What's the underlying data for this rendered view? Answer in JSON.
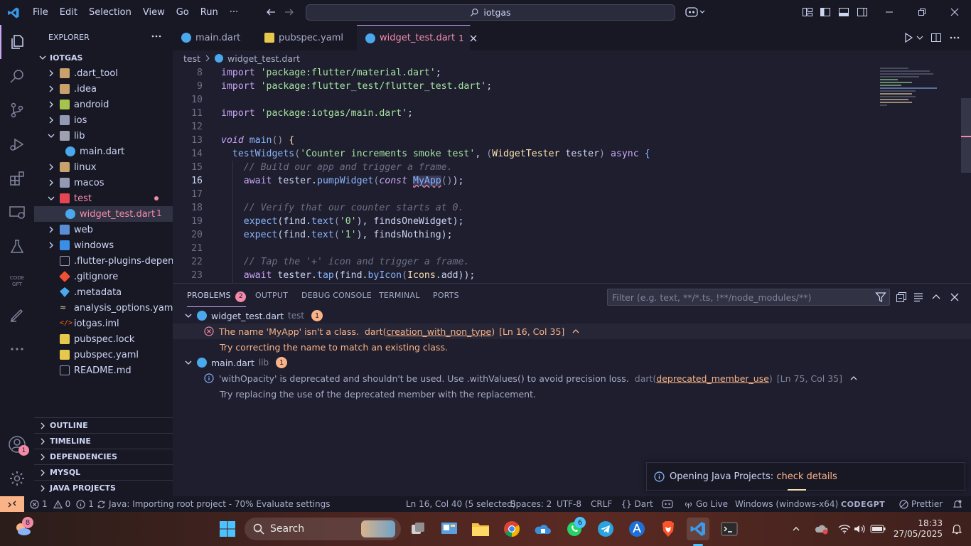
{
  "menu": [
    "File",
    "Edit",
    "Selection",
    "View",
    "Go",
    "Run",
    "···"
  ],
  "search": {
    "value": "iotgas"
  },
  "explorer": {
    "title": "EXPLORER",
    "root": "IOTGAS",
    "items": [
      {
        "label": ".dart_tool"
      },
      {
        "label": ".idea"
      },
      {
        "label": "android"
      },
      {
        "label": "ios"
      },
      {
        "label": "lib"
      },
      {
        "label": "main.dart"
      },
      {
        "label": "linux"
      },
      {
        "label": "macos"
      },
      {
        "label": "test"
      },
      {
        "label": "widget_test.dart",
        "badge": "1"
      },
      {
        "label": "web"
      },
      {
        "label": "windows"
      },
      {
        "label": ".flutter-plugins-depen..."
      },
      {
        "label": ".gitignore"
      },
      {
        "label": ".metadata"
      },
      {
        "label": "analysis_options.yaml"
      },
      {
        "label": "iotgas.iml"
      },
      {
        "label": "pubspec.lock"
      },
      {
        "label": "pubspec.yaml"
      },
      {
        "label": "README.md"
      }
    ],
    "sections": [
      "OUTLINE",
      "TIMELINE",
      "DEPENDENCIES",
      "MYSQL",
      "JAVA PROJECTS"
    ]
  },
  "tabs": [
    {
      "label": "main.dart"
    },
    {
      "label": "pubspec.yaml"
    },
    {
      "label": "widget_test.dart",
      "badge": "1"
    }
  ],
  "breadcrumb": [
    "test",
    "widget_test.dart"
  ],
  "code": {
    "line_numbers": [
      "8",
      "9",
      "10",
      "11",
      "12",
      "13",
      "14",
      "15",
      "16",
      "17",
      "18",
      "19",
      "20",
      "21",
      "22",
      "23"
    ],
    "l8": [
      "import",
      " ",
      "'package:flutter/material.dart'",
      ";"
    ],
    "l9": [
      "import",
      " ",
      "'package:flutter_test/flutter_test.dart'",
      ";"
    ],
    "l11": [
      "import",
      " ",
      "'package:iotgas/main.dart'",
      ";"
    ],
    "l13": [
      "void",
      " ",
      "main",
      "()",
      " {"
    ],
    "l14": [
      "testWidgets",
      "(",
      "'Counter increments smoke test'",
      ", ",
      "(",
      "WidgetTester",
      " tester",
      ")",
      " ",
      "async",
      " {"
    ],
    "l15": "// Build our app and trigger a frame.",
    "l16": [
      "await",
      " tester.",
      "pumpWidget",
      "(",
      "const",
      " ",
      "MyApp",
      "()",
      ");"
    ],
    "l18": "// Verify that our counter starts at 0.",
    "l19": [
      "expect",
      "(find.",
      "text",
      "(",
      "'0'",
      "), findsOneWidget);"
    ],
    "l20": [
      "expect",
      "(find.",
      "text",
      "(",
      "'1'",
      "), findsNothing);"
    ],
    "l22": "// Tap the '+' icon and trigger a frame.",
    "l23": [
      "await",
      " tester.",
      "tap",
      "(find.",
      "byIcon",
      "(",
      "Icons",
      ".add));"
    ]
  },
  "panel": {
    "tabs": [
      "PROBLEMS",
      "OUTPUT",
      "DEBUG CONSOLE",
      "TERMINAL",
      "PORTS"
    ],
    "problems_count": "2",
    "filter_placeholder": "Filter (e.g. text, **/*.ts, !**/node_modules/**)",
    "groups": [
      {
        "file": "widget_test.dart",
        "folder": "test",
        "count": "1",
        "message": "The name 'MyApp' isn't a class.",
        "source": "dart",
        "code": "creation_with_non_type",
        "location": "[Ln 16, Col 35]",
        "hint": "Try correcting the name to match an existing class."
      },
      {
        "file": "main.dart",
        "folder": "lib",
        "count": "1",
        "message": "'withOpacity' is deprecated and shouldn't be used. Use .withValues() to avoid precision loss.",
        "source": "dart",
        "code": "deprecated_member_use",
        "location": "[Ln 75, Col 35]",
        "hint": "Try replacing the use of the deprecated member with the replacement."
      }
    ]
  },
  "notification": {
    "text": "Opening Java Projects: ",
    "link": "check details"
  },
  "status": {
    "errors": "1",
    "warnings": "0",
    "infos": "1",
    "java": "Java: Importing root project - 70% Evaluate settings",
    "cursor": "Ln 16, Col 40 (5 selected)",
    "spaces": "Spaces: 2",
    "encoding": "UTF-8",
    "eol": "CRLF",
    "language": "Dart",
    "golive": "Go Live",
    "device": "Windows (windows-x64)",
    "codegpt": "CODEGPT",
    "prettier": "Prettier"
  },
  "account_badge": "1",
  "taskbar": {
    "search": "Search",
    "weather_badge": "8",
    "whatsapp_badge": "6",
    "time": "18:33",
    "date": "27/05/2025"
  }
}
